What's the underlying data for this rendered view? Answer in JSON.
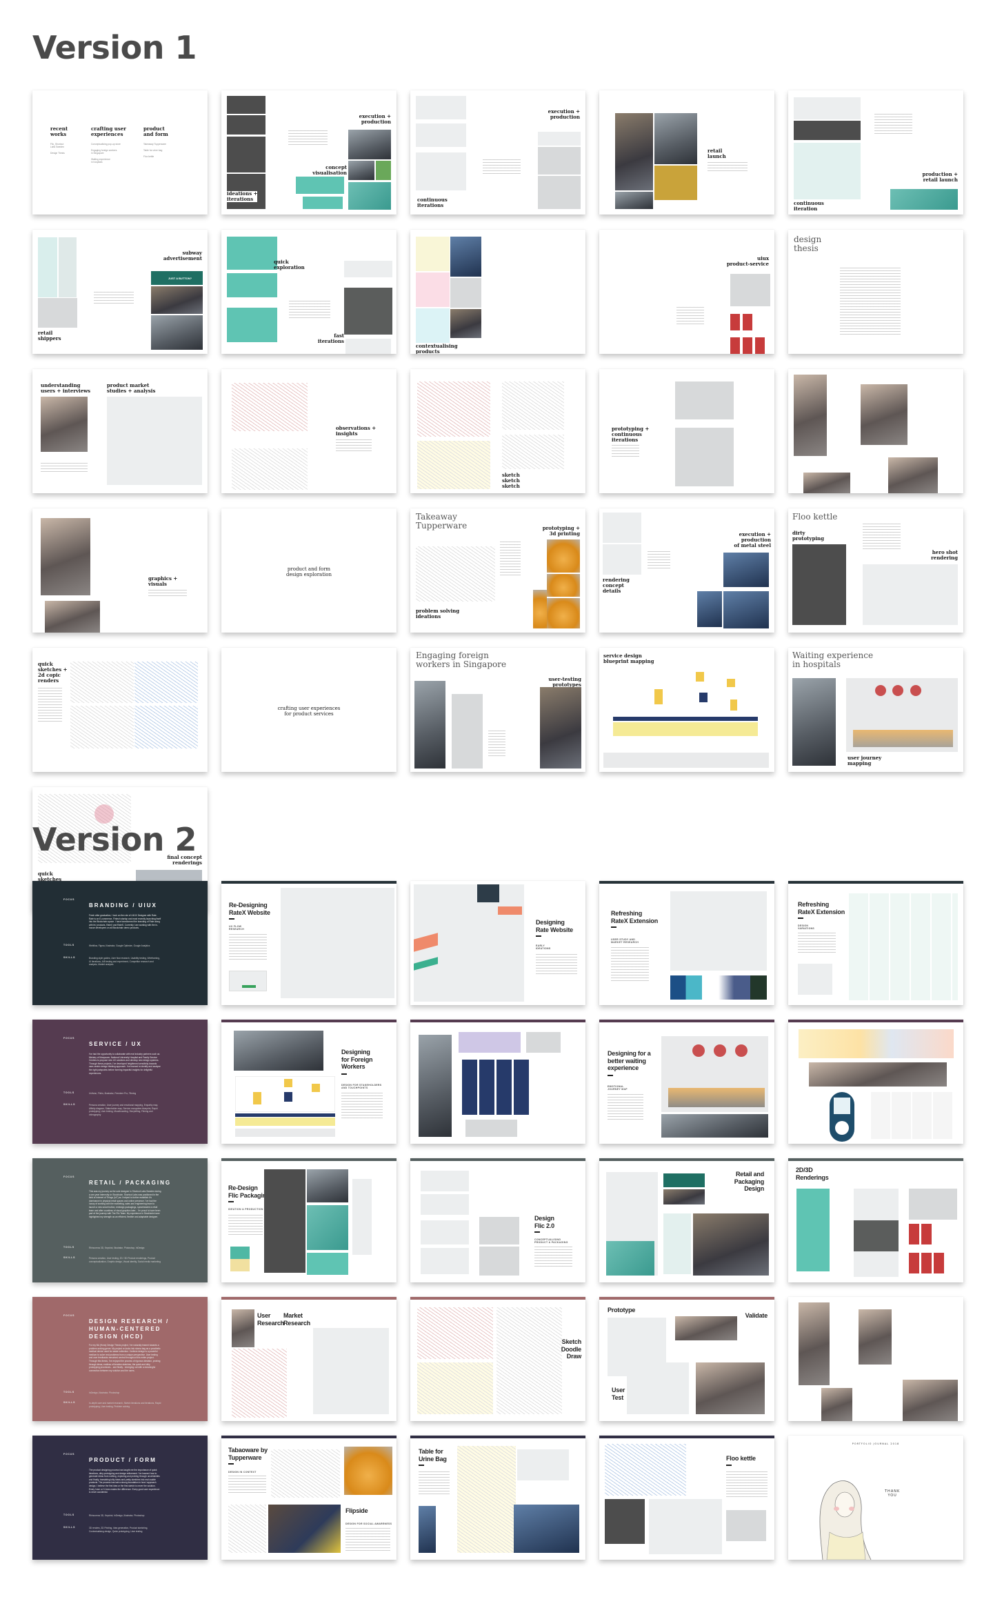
{
  "sections": {
    "v1": {
      "title": "Version 1"
    },
    "v2": {
      "title": "Version 2"
    }
  },
  "v1": {
    "cards": [
      {
        "label_cols": [
          {
            "title": "recent\nworks",
            "items": "Flic_Shortcut\nLabs Sweden\n\nDesign Thesis"
          },
          {
            "title": "crafting user\nexperiences",
            "items": "Conceptualising pop-up store\n\nEngaging foreign workers\nin Singapore\n\nWaiting experience\nin hospitals"
          },
          {
            "title": "product\nand form",
            "items": "Takeaway Tupperware\n\nTable for urine bag\n\nFloo kettle"
          }
        ]
      },
      {
        "labels": [
          "ideations +\niterations",
          "execution +\nproduction",
          "concept\nvisualisation"
        ]
      },
      {
        "labels": [
          "continuous\niterations",
          "execution +\nproduction"
        ]
      },
      {
        "labels": [
          "retail\nlaunch"
        ]
      },
      {
        "labels": [
          "continuous\niteration",
          "production +\nretail launch"
        ]
      },
      {
        "labels": [
          "retail\nshippers",
          "subway\nadvertisement"
        ],
        "ad_text": "JUST A BUTTON?"
      },
      {
        "labels": [
          "quick\nexploration",
          "fast\niterations"
        ]
      },
      {
        "labels": [
          "contextualising\nproducts",
          "uiux\nproduct-service"
        ]
      },
      {
        "labels": [
          "design\nthesis"
        ]
      },
      {
        "labels": [
          "understanding\nusers + interviews",
          "product market\nstudies + analysis"
        ]
      },
      {
        "labels": [
          "observations +\ninsights"
        ]
      },
      {
        "labels": [
          "sketch\nsketch\nsketch"
        ]
      },
      {
        "labels": [
          "prototyping +\ncontinuous\niterations"
        ]
      },
      {
        "labels": []
      },
      {
        "labels": [
          "graphics +\nvisuals"
        ]
      },
      {
        "labels": [
          "product and form\ndesign exploration"
        ]
      },
      {
        "labels": [
          "Takeaway\nTupperware",
          "prototyping +\n3d printing",
          "problem solving\nideations"
        ]
      },
      {
        "labels": [
          "rendering\nconcept\ndetails",
          "execution +\nproduction\nof metal steel"
        ]
      },
      {
        "labels": [
          "Floo kettle",
          "dirty\nprototyping",
          "hero shot\nrendering"
        ]
      },
      {
        "labels": [
          "quick\nsketches +\n2d copic\nrenders"
        ]
      },
      {
        "labels": [
          "crafting user experiences\nfor product services"
        ]
      },
      {
        "labels": [
          "Engaging foreign\nworkers in Singapore",
          "user-testing\nprototypes"
        ]
      },
      {
        "labels": [
          "service design\nblueprint mapping"
        ]
      },
      {
        "labels": [
          "Waiting experience\nin hospitals",
          "user journey\nmapping"
        ]
      },
      {
        "labels": [
          "quick\nsketches",
          "final concept\nrenderings"
        ]
      }
    ]
  },
  "v2": {
    "colors": {
      "branding": "#222e35",
      "service": "#553b50",
      "retail": "#555f5f",
      "research": "#a0696a",
      "product": "#302e44"
    },
    "focus_label": "FOCUS",
    "tools_label": "TOOLS",
    "skills_label": "SKILLS",
    "rows": [
      {
        "dark": {
          "title": "BRANDING / UIUX",
          "text": "Fresh after graduation, I took on the role of UI/UX Designer with Rate. Rate is an E-commerce, Fintech startup and most recently launching itself into the Blockchain space. I have transformed the branding of Rate along with its' products, RateX and RateS. Currently I am working with the in-house developers on all Blockchain demo products.",
          "tools": "Webflow, Figma, Illustrator, Google Optimize, Google Analytics",
          "skills": "Branding style guides, User flow research, Usability testing, Wireframing, UI iterations, A/B testing and experiment, Competitor research and analysis, Market analysis"
        },
        "cards": [
          {
            "title": "Re-Designing\nRateX Website",
            "caption": "UX FLOW\nRESEARCH"
          },
          {
            "title": "Designing\nRate Website",
            "caption": "EARLY\nIDEATIONS"
          },
          {
            "title": "Refreshing\nRateX Extension",
            "caption": "USER STUDY AND\nMARKET RESEARCH"
          },
          {
            "title": "Refreshing\nRateX Extension",
            "caption": "DESIGN\nVARIATIONS"
          }
        ]
      },
      {
        "dark": {
          "title": "SERVICE / UX",
          "text": "I've had the opportunity to collaborate with real industry partners such as Ministry of Manpower, National University Hospital and Family Service Centres to propose new UX solutions and develop new design systems. Through these projects, I've developed heightened sensitivity towards user-centric design thinking approach. I've learned to identify and analyse the right painpoints before forming impactful insights for delightful experiences.",
          "tools": "InVision, Flinto, Illustrator, Premiere Pro, Filming",
          "skills": "Persona creation, User journey and emotional mapping, Empathy map, Affinity diagram, Stakeholder map, Service ecosystem blueprint, Rapid prototyping, User testing, Moodboarding, Storytelling, Filming and videography"
        },
        "cards": [
          {
            "title": "Designing\nfor Foreign\nWorkers",
            "caption": "DESIGN FOR STAKEHOLDERS\nAND TOUCHPOINTS"
          },
          {
            "title": "",
            "caption": ""
          },
          {
            "title": "Designing for a\nbetter waiting\nexperience",
            "caption": "EMOTIONAL\nJOURNEY MAP"
          },
          {
            "title": "",
            "caption": ""
          }
        ]
      },
      {
        "dark": {
          "title": "RETAIL / PACKAGING",
          "text": "This was my journey as the sole designer in Shortcut Labs Sweden during a one-year internship in Stockholm. Shortcut Labs was positioned in the field of Internet of Things (IoT) as I helped to further establish it's dominance in physical retail spaces and online presence. I've had the luxury of working with the marketing, sales and engineering team to launch a new smart button, redesign packagings, spearheaded a retail team and after countless of visual graphics later... I'm proud to have been part of the journey with The Flic Team. My experience in Stockholm have highlighted my strength as an efficient, flexible and adaptable designer.",
          "tools": "Rhinoceros 3D, Keyshot, Illustrator, Photoshop, InDesign",
          "skills": "Persona creation, User testing, 2D / 3D Product renderings, Product conceptualization, Graphic design, Visual identity, Social media marketing"
        },
        "cards": [
          {
            "title": "Re-Design\nFlic Packaging",
            "caption": "IDEATION & PRODUCTION"
          },
          {
            "title": "Design\nFlic 2.0",
            "caption": "CONCEPTUALISING\nPRODUCT & PACKAGING"
          },
          {
            "title": "Retail and\nPackaging\nDesign",
            "caption": ""
          },
          {
            "title": "2D/3D\nRenderings",
            "caption": ""
          }
        ]
      },
      {
        "dark": {
          "title": "DESIGN RESEARCH /\nHUMAN-CENTERED\nDESIGN (HCD)",
          "text": "For my BA (Hons) Design Thesis project, I've naturally leaned towards a problem-solving genre. My project re-looks into stoma bag as a prosthetic medical device used for waste collection. I believe design is a powerful medium to solve real problems from a unique perspective. User testing and user feedbacks remained central throughout this entire project. Through this thesis, I've enjoyed the process of rigorous ideation, probing through ideas, endless of iterative sketches, the quick and dirty prototyping processes... and finally - emerging out with a meaningful connection between my solution and the users.",
          "tools": "InDesign, Illustrator, Photoshop",
          "skills": "In-depth user and market research, Sketch iterations and iterations, Rapid prototyping, User testing, Problem solving"
        },
        "cards": [
          {
            "title": "User\nResearch",
            "title2": "Market\nResearch"
          },
          {
            "title": "Sketch\nDoodle\nDraw"
          },
          {
            "title": "Prototype",
            "title2": "Validate",
            "title3": "User\nTest"
          },
          {
            "title": ""
          }
        ]
      },
      {
        "dark": {
          "title": "PRODUCT / FORM",
          "text": "The product designing process has taught me the importance of quick iterations, dirty prototyping and design refinement. I've learned how to generate ideas from nothing, exploring and probing through uncertainties and finally, translating lofty ideas and pretty sketches into real usable products. The process has laid a strong foundation in how I approach design. I believe the first idea or the first sketch is never the solution. Every 1mm or 0.1mm makes the difference. Every good user experience is never accidental.",
          "tools": "Rhinoceros 3D, Keyshot, InDesign, Illustrator, Photoshop",
          "skills": "3D renders, 3D Printing, Idea generation, Product sketching, Contextualising design, Quick prototyping, User testing"
        },
        "cards": [
          {
            "title": "Tabaoware by\nTupperware",
            "caption": "DESIGN IN CONTEXT",
            "title2": "Flipside",
            "caption2": "DESIGN FOR SOCIAL AWARENESS"
          },
          {
            "title": "Table for\nUrine Bag"
          },
          {
            "title": "Floo kettle"
          },
          {
            "title": "",
            "journal": "PORTFOLIO JOURNAL 2018",
            "thanks": "THANK\nYOU"
          }
        ]
      }
    ]
  }
}
